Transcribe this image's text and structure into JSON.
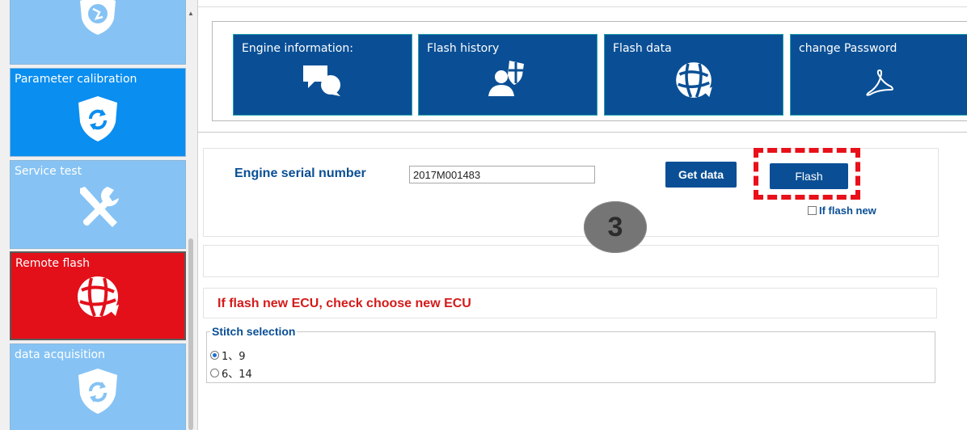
{
  "sidebar": {
    "tiles": [
      {
        "label": "",
        "icon": "globe-shield-icon",
        "color": "#86c3f4"
      },
      {
        "label": "Parameter calibration",
        "icon": "refresh-shield-icon",
        "color": "#0a8ef0"
      },
      {
        "label": "Service test",
        "icon": "tools-icon",
        "color": "#86c3f4"
      },
      {
        "label": "Remote flash",
        "icon": "globe-icon",
        "color": "#e3101a"
      },
      {
        "label": "data acquisition",
        "icon": "refresh-shield-icon",
        "color": "#86c3f4"
      }
    ]
  },
  "toolbar": {
    "buttons": [
      {
        "label": "Engine information:",
        "icon": "chat-bubbles-icon"
      },
      {
        "label": "Flash history",
        "icon": "user-shield-icon"
      },
      {
        "label": "Flash data",
        "icon": "globe-icon"
      },
      {
        "label": "change Password",
        "icon": "acrobat-icon"
      }
    ]
  },
  "main": {
    "serial_label": "Engine serial number",
    "serial_value": "2017M001483",
    "get_data_label": "Get data",
    "flash_label": "Flash",
    "if_flash_new_label": "If flash new",
    "step_number": "3",
    "new_ecu_text": "If flash new ECU, check choose new ECU",
    "stitch_legend": "Stitch selection",
    "stitch_options": [
      {
        "label": "1、9",
        "selected": true
      },
      {
        "label": "6、14",
        "selected": false
      }
    ]
  },
  "colors": {
    "brand_blue": "#0a4f95",
    "highlight_red": "#e8101a",
    "light_tile": "#86c3f4"
  }
}
